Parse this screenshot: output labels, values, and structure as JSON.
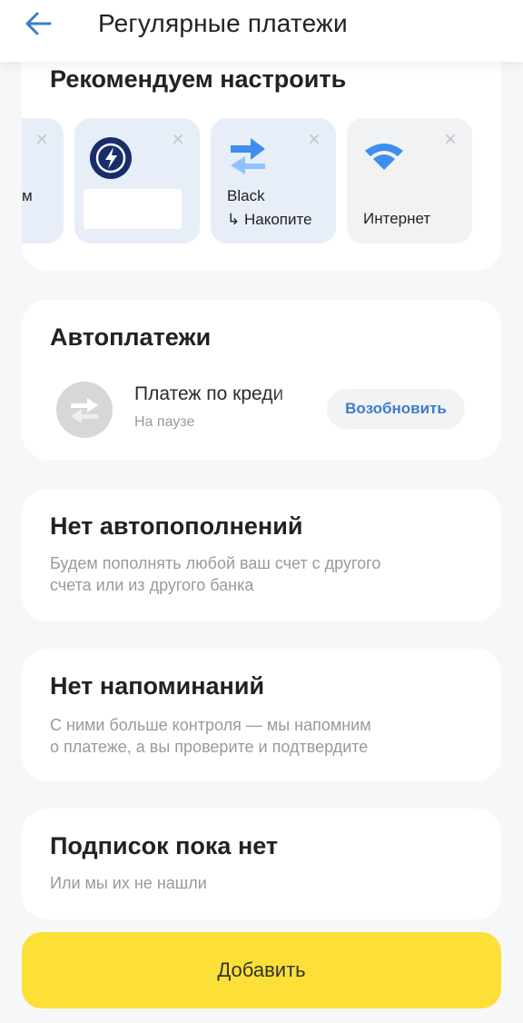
{
  "header": {
    "title": "Регулярные платежи",
    "back_icon": "arrow-left-icon",
    "accent": "#3d7ec6"
  },
  "recommend": {
    "title": "Рекомендуем настроить",
    "tiles": [
      {
        "label": "м"
      },
      {
        "label": ""
      },
      {
        "label": "Black",
        "sublabel": "↳ Накопите"
      },
      {
        "label": "Интернет"
      }
    ]
  },
  "autopay": {
    "title": "Автоплатежи",
    "item": {
      "name": "Платеж по креди",
      "status": "На паузе",
      "action": "Возобновить"
    }
  },
  "topups": {
    "title": "Нет автопополнений",
    "subtitle_line1": "Будем пополнять любой ваш счет с другого",
    "subtitle_line2": "счета или из другого банка"
  },
  "reminders": {
    "title": "Нет напоминаний",
    "subtitle_line1": "С ними больше контроля — мы напомним",
    "subtitle_line2": "о платеже, а вы проверите и подтвердите"
  },
  "subscriptions": {
    "title": "Подписок пока нет",
    "subtitle": "Или мы их не нашли"
  },
  "footer": {
    "add_label": "Добавить",
    "button_color": "#fde037"
  }
}
